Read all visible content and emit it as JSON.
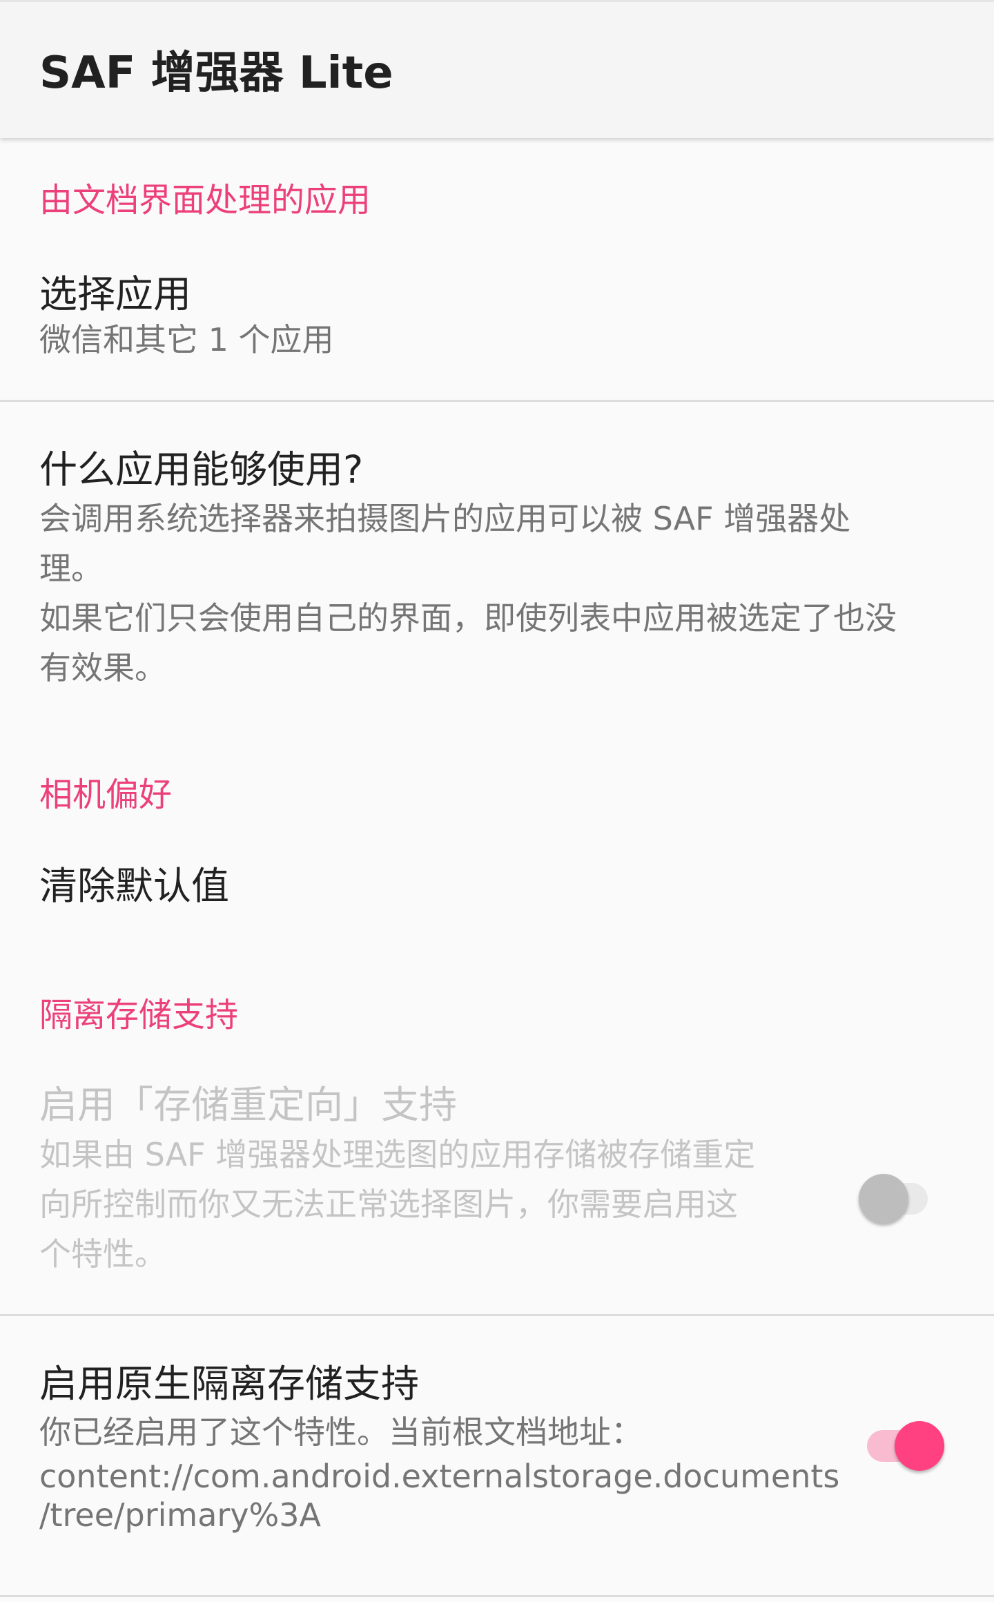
{
  "app_bar": {
    "title": "SAF 增强器 Lite"
  },
  "sections": {
    "doc_ui": {
      "header": "由文档界面处理的应用",
      "select_apps": {
        "title": "选择应用",
        "summary": "微信和其它 1 个应用"
      },
      "what_apps": {
        "title": "什么应用能够使用?",
        "summary_line1": "会调用系统选择器来拍摄图片的应用可以被 SAF 增强器处",
        "summary_line2": "理。",
        "summary_line3": "如果它们只会使用自己的界面，即使列表中应用被选定了也没",
        "summary_line4": "有效果。"
      }
    },
    "camera": {
      "header": "相机偏好",
      "clear_defaults": {
        "title": "清除默认值"
      }
    },
    "isolated_storage": {
      "header": "隔离存储支持",
      "redirect": {
        "title": "启用「存储重定向」支持",
        "summary_line1": "如果由 SAF 增强器处理选图的应用存储被存储重定",
        "summary_line2": "向所控制而你又无法正常选择图片，你需要启用这",
        "summary_line3": "个特性。",
        "enabled": false,
        "checked": false
      },
      "native": {
        "title": "启用原生隔离存储支持",
        "summary_line1": "你已经启用了这个特性。当前根文档地址：",
        "summary_line2": "content://com.android.externalstorage.documents",
        "summary_line3": "/tree/primary%3A",
        "enabled": true,
        "checked": true
      }
    }
  },
  "colors": {
    "accent": "#ff4081",
    "category_header": "#ec407a",
    "background": "#fafafa",
    "app_bar": "#f5f5f5"
  }
}
